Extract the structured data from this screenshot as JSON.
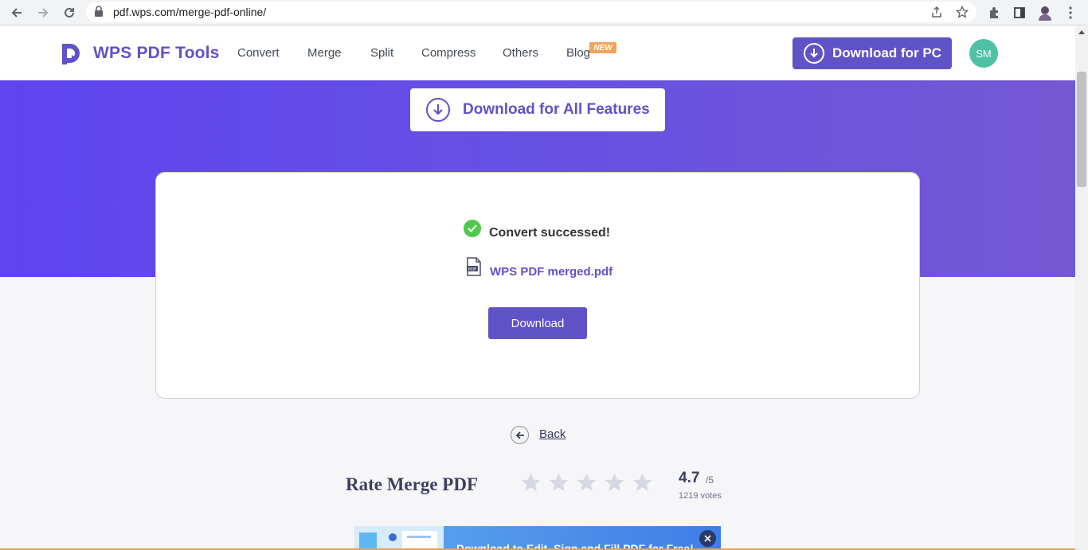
{
  "browser": {
    "url": "pdf.wps.com/merge-pdf-online/"
  },
  "header": {
    "logo_text": "WPS PDF Tools",
    "nav": [
      "Convert",
      "Merge",
      "Split",
      "Compress",
      "Others",
      "Blog"
    ],
    "new_badge": "NEW",
    "download_pc": "Download for PC",
    "avatar_initials": "SM"
  },
  "hero": {
    "download_all": "Download for All Features"
  },
  "result": {
    "status": "Convert successed!",
    "file_name": "WPS PDF merged.pdf",
    "download": "Download"
  },
  "back": {
    "label": "Back"
  },
  "rating": {
    "title": "Rate Merge PDF",
    "score": "4.7",
    "max": "/5",
    "votes": "1219 votes",
    "stars_total": 5,
    "stars_filled": 0
  },
  "banner": {
    "text": "Download to Edit, Sign and Fill PDF for Free!"
  },
  "colors": {
    "brand": "#6052c7",
    "hero_start": "#5f44ef",
    "hero_end": "#7359d2",
    "success": "#4cc94a",
    "badge": "#f2a45a"
  }
}
